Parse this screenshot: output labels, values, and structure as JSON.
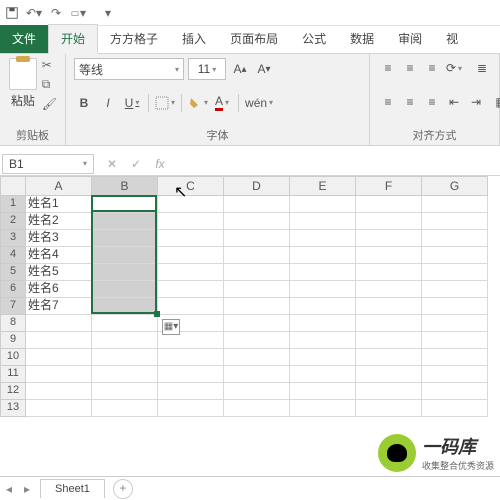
{
  "qat": {
    "save": "保存",
    "undo": "撤销",
    "redo": "重做"
  },
  "tabs": {
    "file": "文件",
    "home": "开始",
    "fangfang": "方方格子",
    "insert": "插入",
    "layout": "页面布局",
    "formula": "公式",
    "data": "数据",
    "review": "审阅",
    "view": "视"
  },
  "ribbon": {
    "clipboard": {
      "paste": "粘贴",
      "label": "剪贴板"
    },
    "font": {
      "name": "等线",
      "size": "11",
      "label": "字体",
      "bold": "B",
      "italic": "I",
      "underline": "U",
      "wen": "wén"
    },
    "align": {
      "label": "对齐方式"
    }
  },
  "namebox": "B1",
  "fx": "fx",
  "cols": [
    "A",
    "B",
    "C",
    "D",
    "E",
    "F",
    "G"
  ],
  "rows": [
    1,
    2,
    3,
    4,
    5,
    6,
    7,
    8,
    9,
    10,
    11,
    12,
    13
  ],
  "dataA": [
    "姓名1",
    "姓名2",
    "姓名3",
    "姓名4",
    "姓名5",
    "姓名6",
    "姓名7"
  ],
  "sheet": "Sheet1",
  "watermark": {
    "title": "一码库",
    "sub": "收集整合优秀资源"
  }
}
